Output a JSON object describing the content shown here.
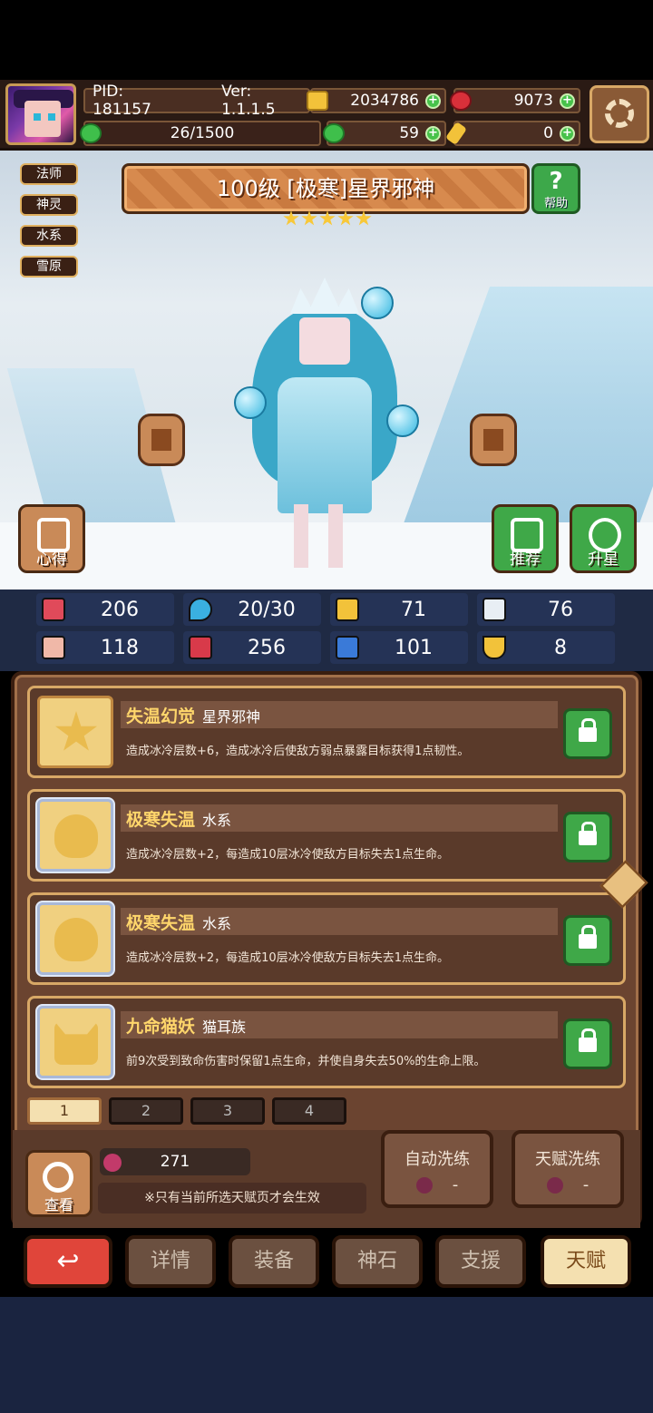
{
  "header": {
    "pid": "PID: 181157",
    "version": "Ver: 1.1.1.5",
    "coins": "2034786",
    "gems": "9073",
    "stamina": "26/1500",
    "clovers": "59",
    "keys": "0"
  },
  "tags": [
    "法师",
    "神灵",
    "水系",
    "雪原"
  ],
  "hero": {
    "title": "100级 [极寒]星界邪神",
    "stars": 5
  },
  "help_label": "帮助",
  "scene_buttons": {
    "xinde": "心得",
    "tuijian": "推荐",
    "shengxing": "升星"
  },
  "stats": {
    "hp": "206",
    "mana": "20/30",
    "defense": "71",
    "speed": "76",
    "attack": "118",
    "magic": "256",
    "crit": "101",
    "luck": "8"
  },
  "talents": [
    {
      "name": "失温幻觉",
      "sub": "星界邪神",
      "desc": "造成冰冷层数+6，造成冰冷后使敌方弱点暴露目标获得1点韧性。"
    },
    {
      "name": "极寒失温",
      "sub": "水系",
      "desc": "造成冰冷层数+2，每造成10层冰冷使敌方目标失去1点生命。"
    },
    {
      "name": "极寒失温",
      "sub": "水系",
      "desc": "造成冰冷层数+2，每造成10层冰冷使敌方目标失去1点生命。"
    },
    {
      "name": "九命猫妖",
      "sub": "猫耳族",
      "desc": "前9次受到致命伤害时保留1点生命，并使自身失去50%的生命上限。"
    }
  ],
  "pages": [
    "1",
    "2",
    "3",
    "4"
  ],
  "bottom": {
    "look": "查看",
    "fruit_count": "271",
    "note": "※只有当前所选天赋页才会生效",
    "auto_wash": "自动洗练",
    "auto_cost": "-",
    "talent_wash": "天赋洗练",
    "talent_cost": "-"
  },
  "nav": {
    "back": "↩",
    "details": "详情",
    "equip": "装备",
    "godstone": "神石",
    "support": "支援",
    "talent": "天赋"
  }
}
